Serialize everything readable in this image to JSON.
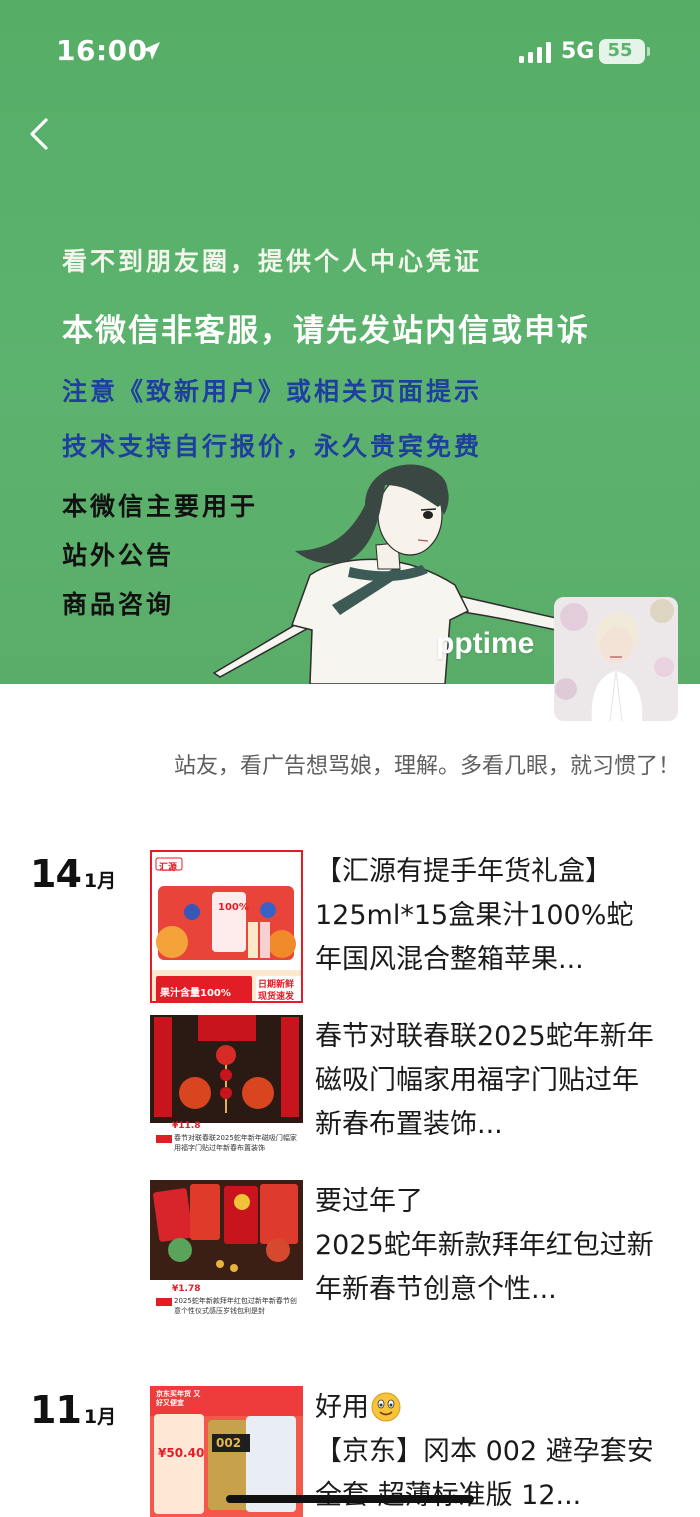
{
  "status_bar": {
    "time": "16:00",
    "network": "5G",
    "battery": "55"
  },
  "cover": {
    "lines": [
      "看不到朋友圈，提供个人中心凭证",
      "本微信非客服，请先发站内信或申诉",
      "注意《致新用户》或相关页面提示",
      "技术支持自行报价，永久贵宾免费",
      "本微信主要用于",
      "站外公告",
      "商品咨询"
    ]
  },
  "profile": {
    "name": "pptime",
    "signature": "站友，看广告想骂娘，理解。多看几眼，就习惯了！"
  },
  "days": [
    {
      "day": "14",
      "month": "1月"
    },
    {
      "day": "11",
      "month": "1月"
    }
  ],
  "posts": [
    {
      "text": "【汇源有提手年货礼盒】125ml*15盒果汁100%蛇年国风混合整箱苹果...",
      "thumb": {
        "brand": "汇源",
        "label1": "100%",
        "label2": "果汁含量100%",
        "label3": "日期新鲜",
        "label4": "现货速发"
      }
    },
    {
      "text": "春节对联春联2025蛇年新年磁吸门幅家用福字门贴过年新春布置装饰...",
      "thumb": {
        "price": "¥11.8",
        "caption": "春节对联春联2025蛇年新年磁吸门幅家用福字门贴过年新春布置装饰"
      }
    },
    {
      "text_line1": "要过年了",
      "text": "2025蛇年新款拜年红包过新年新春节创意个性...",
      "thumb": {
        "price": "¥1.78",
        "caption": "2025蛇年新款拜年红包过新年新春节创意个性仪式感压岁钱包利是封"
      }
    },
    {
      "text_line1": "好用",
      "text": "【京东】冈本 002 避孕套安全套 超薄标准版 12...",
      "thumb": {
        "badge": "京东买年货 又好又便宜",
        "price": "¥50.40",
        "product": "002"
      }
    }
  ],
  "colors": {
    "cover_green": "#5cb36e",
    "blue_text": "#1e3f9e",
    "jd_red": "#e4393c"
  }
}
